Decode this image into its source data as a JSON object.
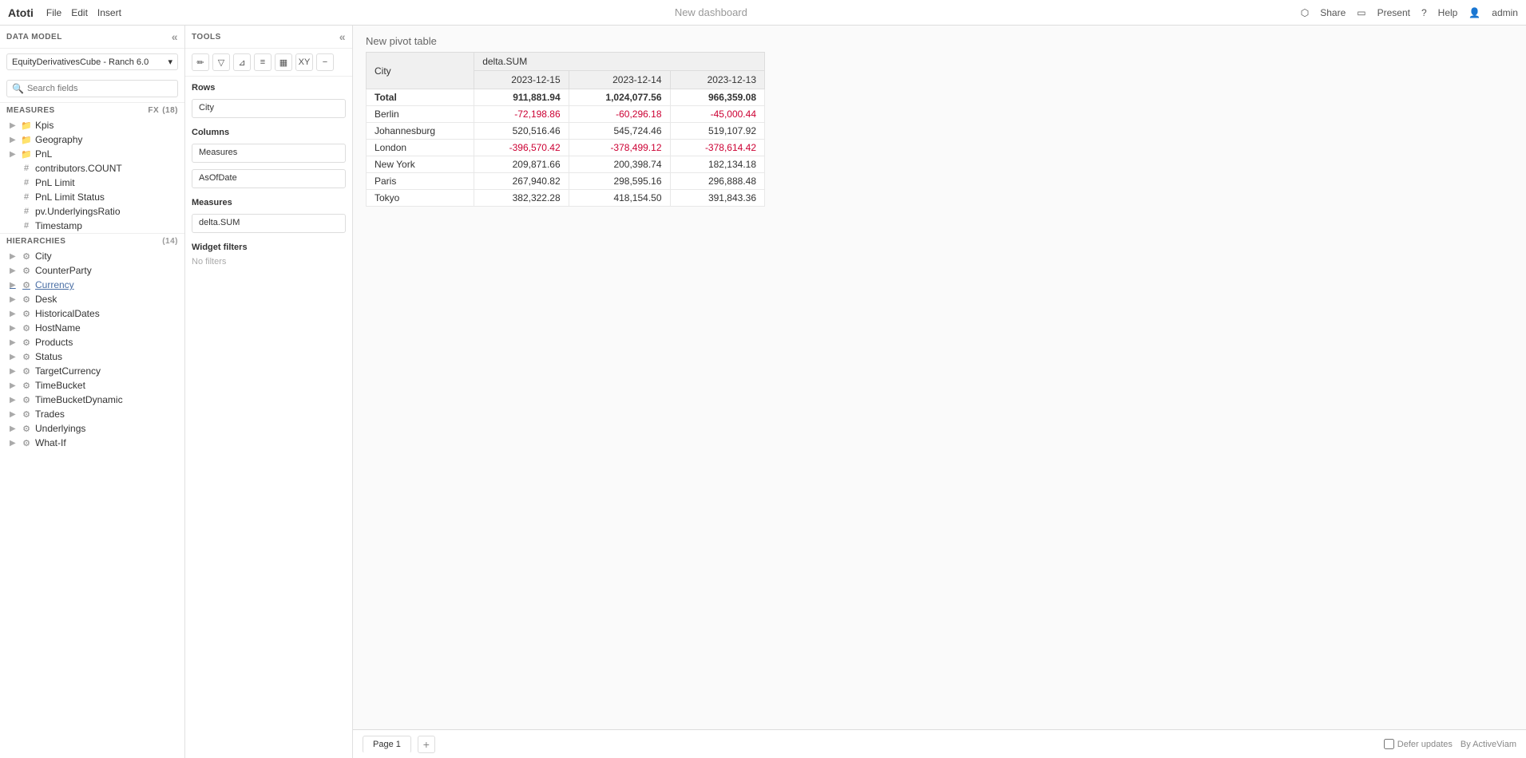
{
  "app": {
    "logo": "Atoti",
    "menu": [
      "File",
      "Edit",
      "Insert"
    ],
    "title": "New dashboard",
    "actions": {
      "share": "Share",
      "present": "Present",
      "help": "Help",
      "user": "admin"
    }
  },
  "left_panel": {
    "header": "DATA MODEL",
    "cube": "EquityDerivativesCube - Ranch 6.0",
    "search_placeholder": "Search fields",
    "measures_header": "MEASURES",
    "measures_count": "(18)",
    "measures": [
      {
        "name": "Kpis",
        "type": "folder",
        "expandable": true
      },
      {
        "name": "Geography",
        "type": "folder",
        "expandable": true
      },
      {
        "name": "PnL",
        "type": "folder",
        "expandable": true
      },
      {
        "name": "contributors.COUNT",
        "type": "number"
      },
      {
        "name": "PnL Limit",
        "type": "number"
      },
      {
        "name": "PnL Limit Status",
        "type": "number"
      },
      {
        "name": "pv.UnderlyingsRatio",
        "type": "number"
      },
      {
        "name": "Timestamp",
        "type": "number"
      }
    ],
    "hierarchies_header": "HIERARCHIES",
    "hierarchies_count": "(14)",
    "hierarchies": [
      {
        "name": "City",
        "expandable": true
      },
      {
        "name": "CounterParty",
        "expandable": true
      },
      {
        "name": "Currency",
        "expandable": true,
        "active": true
      },
      {
        "name": "Desk",
        "expandable": true
      },
      {
        "name": "HistoricalDates",
        "expandable": true
      },
      {
        "name": "HostName",
        "expandable": true
      },
      {
        "name": "Products",
        "expandable": true
      },
      {
        "name": "Status",
        "expandable": true
      },
      {
        "name": "TargetCurrency",
        "expandable": true
      },
      {
        "name": "TimeBucket",
        "expandable": true
      },
      {
        "name": "TimeBucketDynamic",
        "expandable": true
      },
      {
        "name": "Trades",
        "expandable": true
      },
      {
        "name": "Underlyings",
        "expandable": true
      },
      {
        "name": "What-If",
        "expandable": true
      }
    ]
  },
  "tools_panel": {
    "header": "TOOLS",
    "toolbar_buttons": [
      "pencil",
      "filter",
      "funnel",
      "bars",
      "box",
      "xy",
      "minus"
    ],
    "rows_label": "Rows",
    "rows_value": "City",
    "columns_label": "Columns",
    "columns": [
      "Measures",
      "AsOfDate"
    ],
    "measures_label": "Measures",
    "measures_value": "delta.SUM",
    "widget_filters_label": "Widget filters",
    "no_filters": "No filters"
  },
  "pivot_table": {
    "title": "New pivot table",
    "col_city": "City",
    "col_measure": "delta.SUM",
    "dates": [
      "2023-12-15",
      "2023-12-14",
      "2023-12-13"
    ],
    "rows": [
      {
        "city": "Total",
        "v1": "911,881.94",
        "v2": "1,024,077.56",
        "v3": "966,359.08",
        "neg1": false,
        "neg2": false,
        "neg3": false
      },
      {
        "city": "Berlin",
        "v1": "-72,198.86",
        "v2": "-60,296.18",
        "v3": "-45,000.44",
        "neg1": true,
        "neg2": true,
        "neg3": true
      },
      {
        "city": "Johannesburg",
        "v1": "520,516.46",
        "v2": "545,724.46",
        "v3": "519,107.92",
        "neg1": false,
        "neg2": false,
        "neg3": false
      },
      {
        "city": "London",
        "v1": "-396,570.42",
        "v2": "-378,499.12",
        "v3": "-378,614.42",
        "neg1": true,
        "neg2": true,
        "neg3": true
      },
      {
        "city": "New York",
        "v1": "209,871.66",
        "v2": "200,398.74",
        "v3": "182,134.18",
        "neg1": false,
        "neg2": false,
        "neg3": false
      },
      {
        "city": "Paris",
        "v1": "267,940.82",
        "v2": "298,595.16",
        "v3": "296,888.48",
        "neg1": false,
        "neg2": false,
        "neg3": false
      },
      {
        "city": "Tokyo",
        "v1": "382,322.28",
        "v2": "418,154.50",
        "v3": "391,843.36",
        "neg1": false,
        "neg2": false,
        "neg3": false
      }
    ]
  },
  "bottom_bar": {
    "page_label": "Page 1",
    "add_tab": "+",
    "defer_updates": "Defer updates",
    "by_label": "By ActiveViam"
  }
}
